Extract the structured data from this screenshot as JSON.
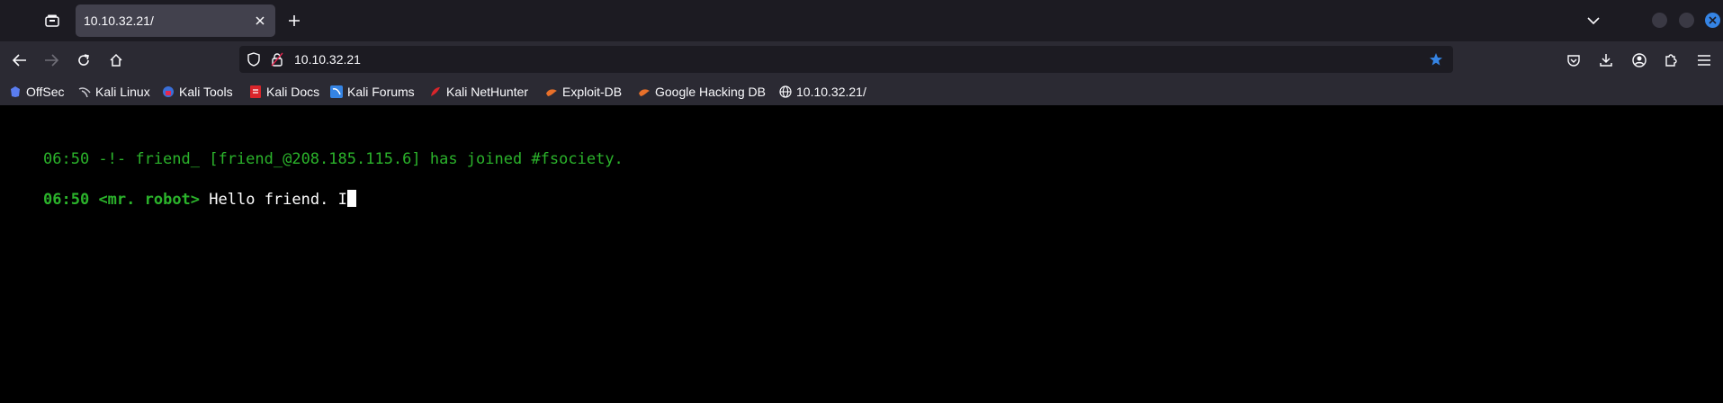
{
  "tab": {
    "title": "10.10.32.21/"
  },
  "address": {
    "url": "10.10.32.21"
  },
  "bookmarks": [
    {
      "label": "OffSec",
      "icon": "offsec-icon"
    },
    {
      "label": "Kali Linux",
      "icon": "kali-dragon-icon"
    },
    {
      "label": "Kali Tools",
      "icon": "kali-tools-icon"
    },
    {
      "label": "Kali Docs",
      "icon": "kali-docs-icon"
    },
    {
      "label": "Kali Forums",
      "icon": "kali-forums-icon"
    },
    {
      "label": "Kali NetHunter",
      "icon": "nethunter-icon"
    },
    {
      "label": "Exploit-DB",
      "icon": "exploit-db-icon"
    },
    {
      "label": "Google Hacking DB",
      "icon": "ghdb-icon"
    },
    {
      "label": "10.10.32.21/",
      "icon": "globe-icon"
    }
  ],
  "terminal": {
    "line1": "06:50 -!- friend_ [friend_@208.185.115.6] has joined #fsociety.",
    "line2_time": "06:50",
    "line2_nick": "<mr. robot>",
    "line2_msg": "Hello friend. I"
  },
  "colors": {
    "accent": "#3584e4",
    "terminal_green": "#2bb32b",
    "background": "#000000"
  }
}
